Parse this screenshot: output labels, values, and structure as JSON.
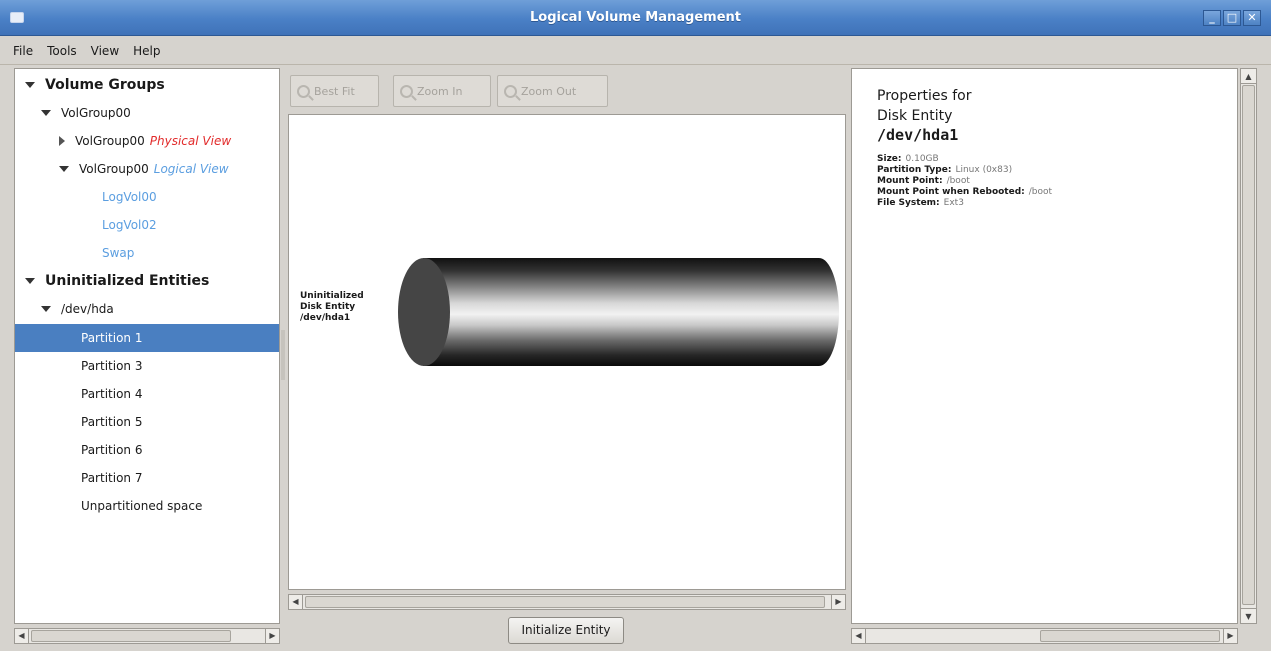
{
  "window": {
    "title": "Logical Volume Management",
    "minimize": "_",
    "maximize": "□",
    "close": "✕"
  },
  "menu": {
    "file": "File",
    "tools": "Tools",
    "view": "View",
    "help": "Help"
  },
  "tree": {
    "volume_groups": "Volume Groups",
    "vg": "VolGroup00",
    "vg_physical_name": "VolGroup00",
    "physical_view": "Physical View",
    "vg_logical_name": "VolGroup00",
    "logical_view": "Logical View",
    "lv1": "LogVol00",
    "lv2": "LogVol02",
    "lv3": "Swap",
    "uninit": "Uninitialized Entities",
    "device": "/dev/hda",
    "partitions": [
      "Partition 1",
      "Partition 3",
      "Partition 4",
      "Partition 5",
      "Partition 6",
      "Partition 7",
      "Unpartitioned space"
    ],
    "selected": "Partition 1"
  },
  "toolbar": {
    "best_fit": "Best Fit",
    "zoom_in": "Zoom In",
    "zoom_out": "Zoom Out"
  },
  "canvas": {
    "label_line1": "Uninitialized",
    "label_line2": "Disk Entity",
    "label_line3": "/dev/hda1"
  },
  "actions": {
    "initialize": "Initialize Entity"
  },
  "properties": {
    "heading_line1": "Properties for",
    "heading_line2": "Disk Entity",
    "device": "/dev/hda1",
    "fields": [
      {
        "key": "Size:",
        "value": "0.10GB"
      },
      {
        "key": "Partition Type:",
        "value": "Linux (0x83)"
      },
      {
        "key": "Mount Point:",
        "value": "/boot"
      },
      {
        "key": "Mount Point when Rebooted:",
        "value": "/boot"
      },
      {
        "key": "File System:",
        "value": "Ext3"
      }
    ]
  },
  "colors": {
    "selection": "#4a7fc1",
    "physical_view": "#e22b2b",
    "logical_view": "#5b9ee0",
    "titlebar": "#4a80c6"
  }
}
